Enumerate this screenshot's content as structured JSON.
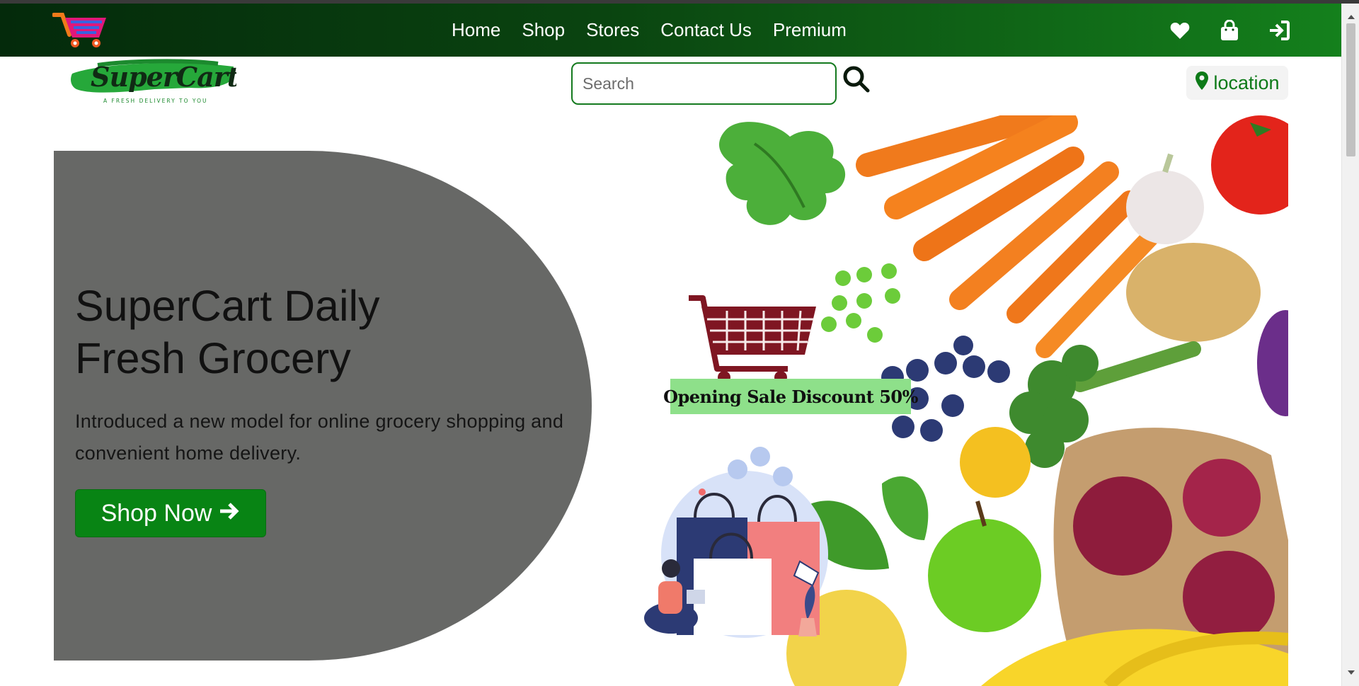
{
  "nav": {
    "links": [
      "Home",
      "Shop",
      "Stores",
      "Contact Us",
      "Premium"
    ],
    "icons": [
      "heart-icon",
      "shopping-bag-icon",
      "sign-in-icon"
    ]
  },
  "brand": {
    "logo_text": "SuperCart",
    "tagline": "A FRESH DELIVERY TO YOU"
  },
  "search": {
    "placeholder": "Search",
    "value": ""
  },
  "location": {
    "label": "location"
  },
  "hero": {
    "title_line1": "SuperCart Daily",
    "title_line2": "Fresh Grocery",
    "description": "Introduced a new model for online grocery shopping and convenient home delivery.",
    "cta_label": "Shop Now",
    "promo_text": "Opening Sale Discount 50%"
  },
  "colors": {
    "nav_dark": "#042a0b",
    "nav_light": "#14801c",
    "accent_green": "#088414",
    "hero_panel": "#676866",
    "promo_banner": "#8ee08a",
    "cart_red": "#7f1622"
  }
}
